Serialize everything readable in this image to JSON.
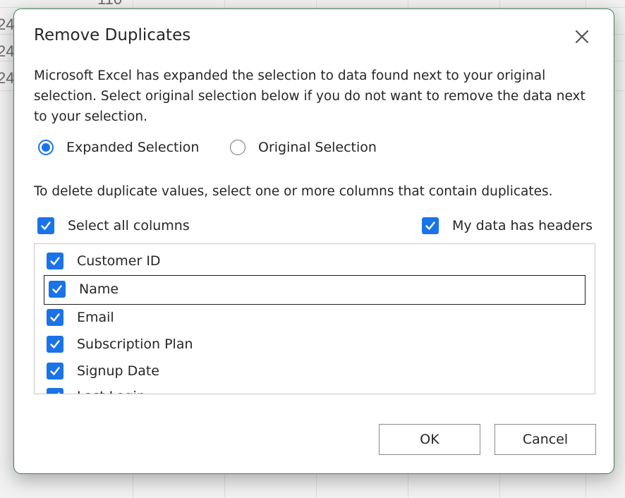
{
  "background": {
    "cells": [
      "110",
      "24",
      "24",
      "24"
    ]
  },
  "dialog": {
    "title": "Remove Duplicates",
    "description": "Microsoft Excel has expanded the selection to data found next to your original selection. Select original selection below if you do not want to remove the data next to your selection.",
    "radio_options": [
      {
        "label": "Expanded Selection",
        "selected": true
      },
      {
        "label": "Original Selection",
        "selected": false
      }
    ],
    "instruction": "To delete duplicate values, select one or more columns that contain duplicates.",
    "select_all_label": "Select all columns",
    "select_all_checked": true,
    "headers_label": "My data has headers",
    "headers_checked": true,
    "columns": [
      {
        "label": "Customer ID",
        "checked": true
      },
      {
        "label": "Name",
        "checked": true
      },
      {
        "label": "Email",
        "checked": true
      },
      {
        "label": "Subscription Plan",
        "checked": true
      },
      {
        "label": "Signup Date",
        "checked": true
      },
      {
        "label": "Last Login",
        "checked": true
      }
    ],
    "ok_label": "OK",
    "cancel_label": "Cancel"
  },
  "colors": {
    "accent": "#1a73e8",
    "dialog_border": "#3f7f4a"
  },
  "icons": {
    "close": "close-icon",
    "check": "checkmark-icon"
  }
}
